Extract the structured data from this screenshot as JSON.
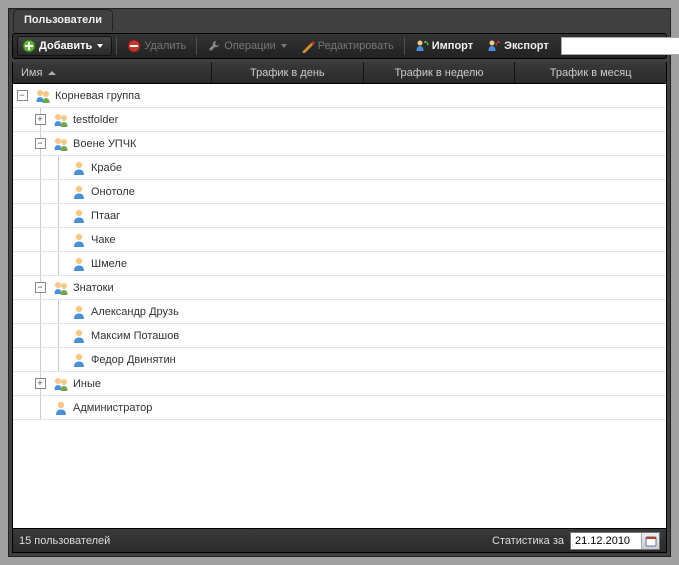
{
  "tab": {
    "label": "Пользователи"
  },
  "toolbar": {
    "add": "Добавить",
    "delete": "Удалить",
    "operations": "Операции",
    "edit": "Редактировать",
    "import": "Импорт",
    "export": "Экспорт",
    "search_value": ""
  },
  "columns": {
    "name": "Имя",
    "traffic_day": "Трафик в день",
    "traffic_week": "Трафик в неделю",
    "traffic_month": "Трафик в месяц"
  },
  "tree": {
    "root": {
      "label": "Корневая группа",
      "type": "group",
      "expanded": true
    },
    "testfolder": {
      "label": "testfolder",
      "type": "group",
      "expanded": false
    },
    "upchk": {
      "label": "Воене УПЧК",
      "type": "group",
      "expanded": true
    },
    "krabe": {
      "label": "Крабе",
      "type": "user"
    },
    "onotole": {
      "label": "Онотоле",
      "type": "user"
    },
    "ptaag": {
      "label": "Птааг",
      "type": "user"
    },
    "chake": {
      "label": "Чаке",
      "type": "user"
    },
    "shmele": {
      "label": "Шмеле",
      "type": "user"
    },
    "znatoki": {
      "label": "Знатоки",
      "type": "group",
      "expanded": true
    },
    "druz": {
      "label": "Александр Друзь",
      "type": "user"
    },
    "potashov": {
      "label": "Максим Поташов",
      "type": "user"
    },
    "dvinyatin": {
      "label": "Федор Двинятин",
      "type": "user"
    },
    "inye": {
      "label": "Иные",
      "type": "group",
      "expanded": false
    },
    "admin": {
      "label": "Администратор",
      "type": "user"
    }
  },
  "status": {
    "count_text": "15 пользователей",
    "stats_label": "Статистика за",
    "date": "21.12.2010"
  }
}
